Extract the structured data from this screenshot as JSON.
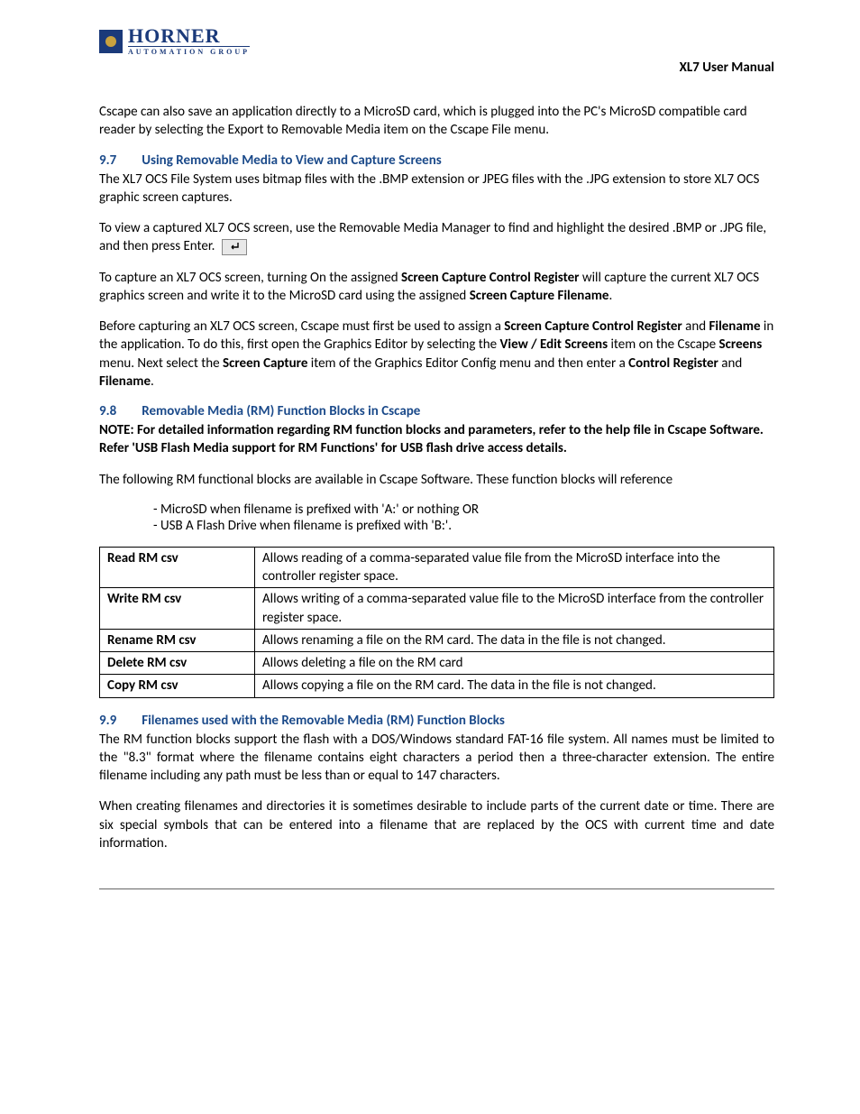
{
  "header": {
    "brand": "HORNER",
    "brand_sub": "AUTOMATION GROUP",
    "doc_title": "XL7 User Manual"
  },
  "intro_paragraph_before": "Cscape can also save an application directly to a MicroSD card, which is plugged into the PC's MicroSD compatible card reader by selecting the Export to Removable Media item on the Cscape File menu.",
  "section97": {
    "num": "9.7",
    "title": "Using Removable Media to View and Capture Screens",
    "p1": "The XL7 OCS File System uses bitmap files with the .BMP extension or JPEG files with the .JPG extension to store XL7 OCS graphic screen captures.",
    "p2_a": "To view a captured XL7 OCS screen, use the Removable Media Manager to find and highlight the desired .BMP or .JPG file, and then press Enter.",
    "p3_a": "To capture an XL7 OCS screen, turning On the assigned ",
    "p3_b1": "Screen Capture Control Register",
    "p3_c": " will capture the current XL7 OCS graphics screen and write it to the MicroSD card using the assigned ",
    "p3_b2": "Screen Capture Filename",
    "p3_d": ".",
    "p4_a": "Before capturing an XL7 OCS screen, Cscape must first be used to assign a ",
    "p4_b1": "Screen Capture Control Register",
    "p4_c": " and ",
    "p4_b2": "Filename",
    "p4_d": " in the application.  To do this, first open the Graphics Editor by selecting the ",
    "p4_b3": "View / Edit Screens",
    "p4_e": " item on the Cscape ",
    "p4_b4": "Screens",
    "p4_f": " menu.  Next select the ",
    "p4_b5": "Screen Capture",
    "p4_g": " item of the Graphics Editor Config menu and then enter a ",
    "p4_b6": "Control Register",
    "p4_h": " and ",
    "p4_b7": "Filename",
    "p4_i": "."
  },
  "section98": {
    "num": "9.8",
    "title": "Removable Media (RM) Function Blocks in Cscape",
    "note": "NOTE: For detailed information regarding RM function blocks and parameters, refer to the help file in Cscape Software. Refer 'USB Flash Media support for RM Functions' for USB flash drive access details.",
    "p2": "The following RM functional blocks are available in Cscape Software. These function blocks will reference",
    "refs": [
      "MicroSD when filename is prefixed with 'A:' or nothing OR",
      "USB A Flash Drive when filename is prefixed with 'B:'."
    ],
    "table": [
      {
        "name": "Read RM csv",
        "desc": "Allows reading of a comma-separated value file from the MicroSD interface into the controller register space."
      },
      {
        "name": "Write RM csv",
        "desc": "Allows writing of a comma-separated value file to the MicroSD interface from the controller register space."
      },
      {
        "name": "Rename RM csv",
        "desc": "Allows renaming a file on the RM card. The data in the file is not changed."
      },
      {
        "name": "Delete RM csv",
        "desc": "Allows deleting a file on the RM card"
      },
      {
        "name": "Copy RM csv",
        "desc": "Allows copying a file on the RM card. The data in the file is not changed."
      }
    ]
  },
  "section99": {
    "num": "9.9",
    "title": "Filenames used with the Removable Media (RM) Function Blocks",
    "p1": "The RM function blocks support the flash with a DOS/Windows standard FAT-16 file system. All names must be limited to the \"8.3\" format where the filename contains eight characters a period then a three-character extension. The entire filename including any path must be less than or equal to 147 characters.",
    "p2": "When creating filenames and directories it is sometimes desirable to include parts of the current date or time. There are six special symbols that can be entered into a filename that are replaced by the OCS with current time and date information."
  }
}
